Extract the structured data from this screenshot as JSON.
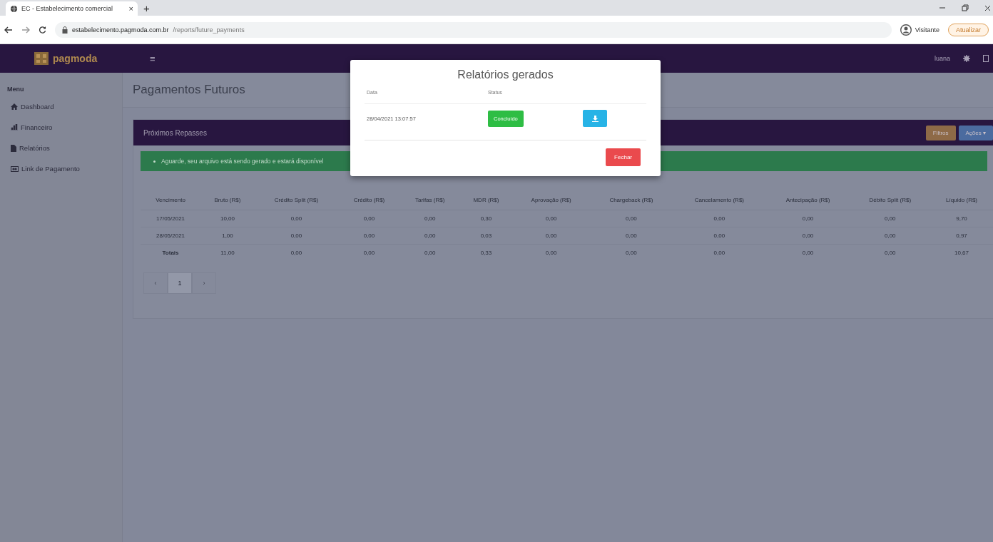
{
  "browser": {
    "tab_title": "EC - Estabelecimento comercial",
    "tab_close": "×",
    "new_tab": "+",
    "url_host": "estabelecimento.pagmoda.com.br",
    "url_path": "/reports/future_payments",
    "profile": "Visitante",
    "update": "Atualizar"
  },
  "topbar": {
    "logo": "pagmoda",
    "menu_toggle": "≡",
    "user": "luana"
  },
  "sidebar": {
    "heading": "Menu",
    "items": [
      {
        "label": "Dashboard"
      },
      {
        "label": "Financeiro"
      },
      {
        "label": "Relatórios"
      },
      {
        "label": "Link de Pagamento"
      }
    ]
  },
  "page_title": "Pagamentos Futuros",
  "panel": {
    "title": "Próximos Repasses",
    "buttons": [
      {
        "label": "Filtros",
        "kind": "filter"
      },
      {
        "label": "Ações ▾",
        "kind": "actions"
      }
    ],
    "alert": "Aguarde, seu arquivo está sendo gerado e estará disponível",
    "table": {
      "columns": [
        "Vencimento",
        "Bruto (R$)",
        "Crédito Split (R$)",
        "Crédito (R$)",
        "Tarifas (R$)",
        "MDR (R$)",
        "Aprovação (R$)",
        "Chargeback (R$)",
        "Cancelamento (R$)",
        "Antecipação (R$)",
        "Débito Split (R$)",
        "Líquido (R$)"
      ],
      "rows": [
        {
          "kind": "data",
          "cells": [
            "17/05/2021",
            "10,00",
            "0,00",
            "0,00",
            "0,00",
            "0,30",
            "0,00",
            "0,00",
            "0,00",
            "0,00",
            "0,00",
            "9,70"
          ]
        },
        {
          "kind": "data",
          "cells": [
            "28/05/2021",
            "1,00",
            "0,00",
            "0,00",
            "0,00",
            "0,03",
            "0,00",
            "0,00",
            "0,00",
            "0,00",
            "0,00",
            "0,97"
          ]
        },
        {
          "kind": "total",
          "cells": [
            "Totais",
            "11,00",
            "0,00",
            "0,00",
            "0,00",
            "0,33",
            "0,00",
            "0,00",
            "0,00",
            "0,00",
            "0,00",
            "10,67"
          ]
        }
      ]
    },
    "pagination": [
      {
        "label": "‹",
        "selected": false
      },
      {
        "label": "1",
        "selected": true
      },
      {
        "label": "›",
        "selected": false
      }
    ]
  },
  "modal": {
    "title": "Relatórios gerados",
    "columns": [
      "Data",
      "Status"
    ],
    "rows": [
      {
        "date": "28/04/2021 13:07:57",
        "status": "Concluído"
      }
    ],
    "close_button": "Fechar"
  }
}
